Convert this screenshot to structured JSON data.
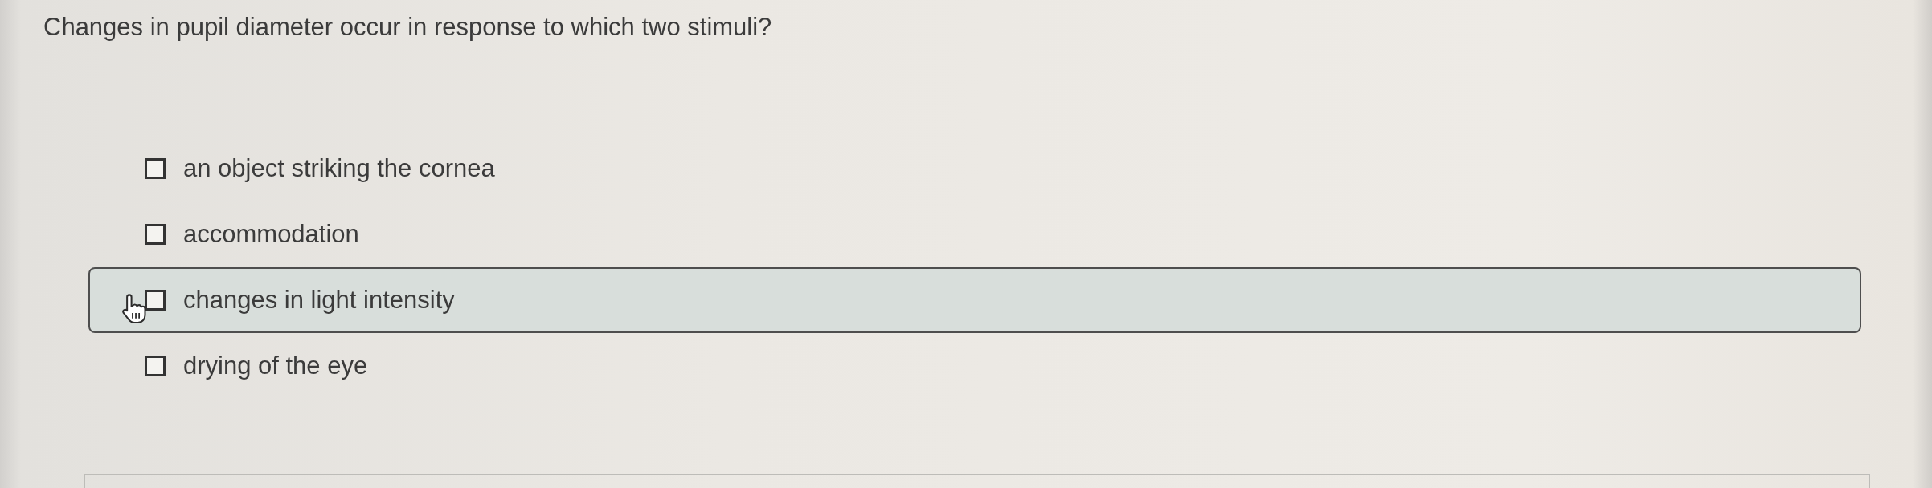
{
  "question": {
    "text": "Changes in pupil diameter occur in response to which two stimuli?"
  },
  "options": [
    {
      "label": "an object striking the cornea",
      "checked": false,
      "hovered": false
    },
    {
      "label": "accommodation",
      "checked": false,
      "hovered": false
    },
    {
      "label": "changes in light intensity",
      "checked": false,
      "hovered": true
    },
    {
      "label": "drying of the eye",
      "checked": false,
      "hovered": false
    }
  ]
}
